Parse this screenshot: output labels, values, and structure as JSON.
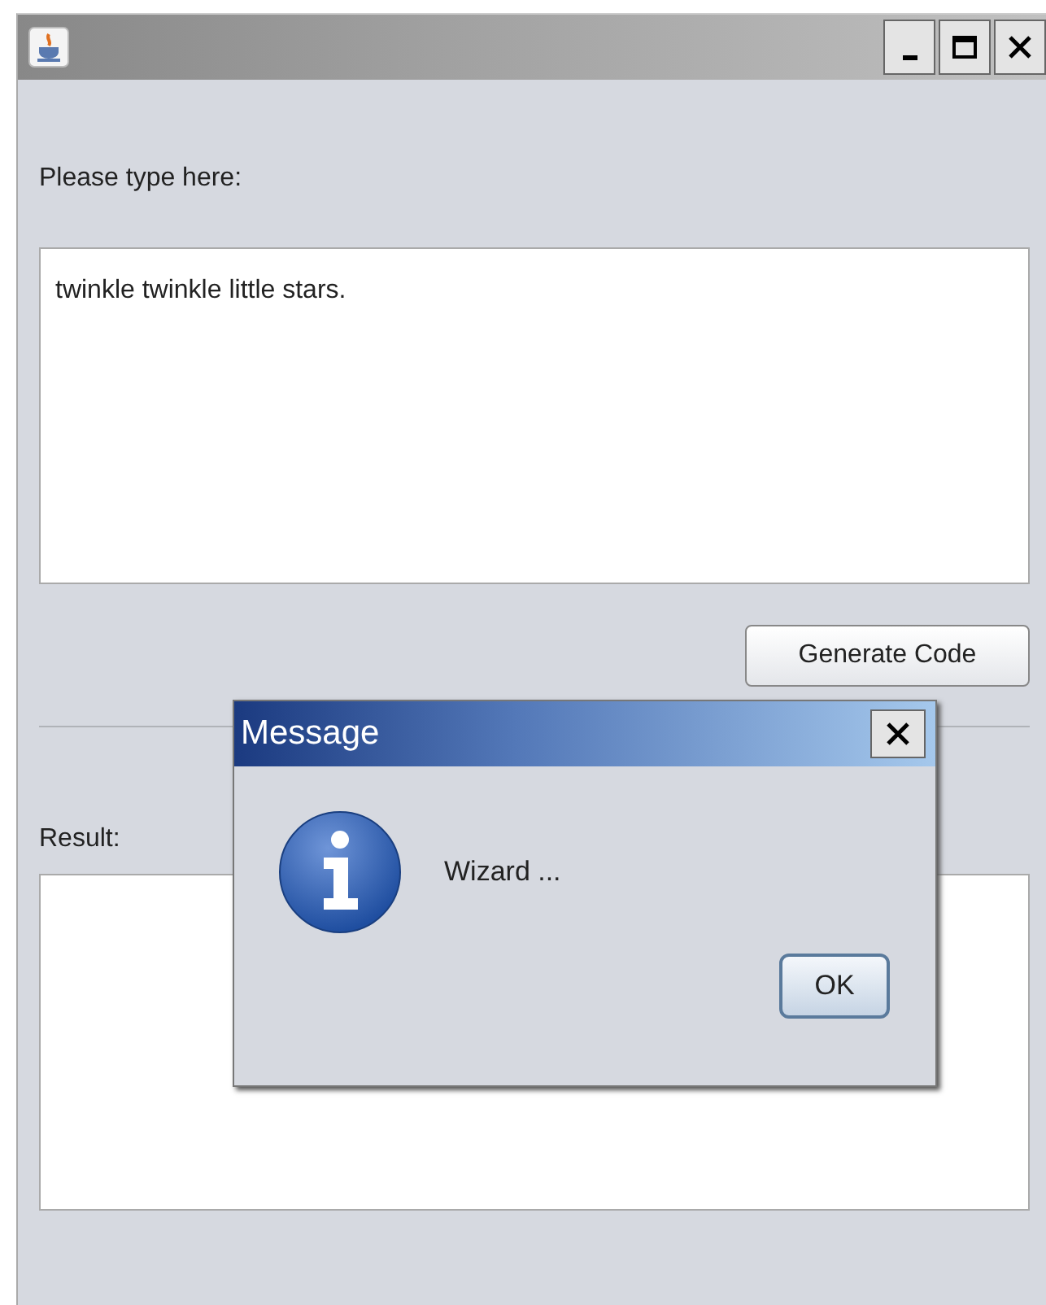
{
  "main": {
    "input_label": "Please type here:",
    "input_value": "twinkle twinkle little stars.",
    "generate_button": "Generate Code",
    "result_label": "Result:"
  },
  "dialog": {
    "title": "Message",
    "message": "Wizard ...",
    "buttons": [
      "OK"
    ]
  }
}
